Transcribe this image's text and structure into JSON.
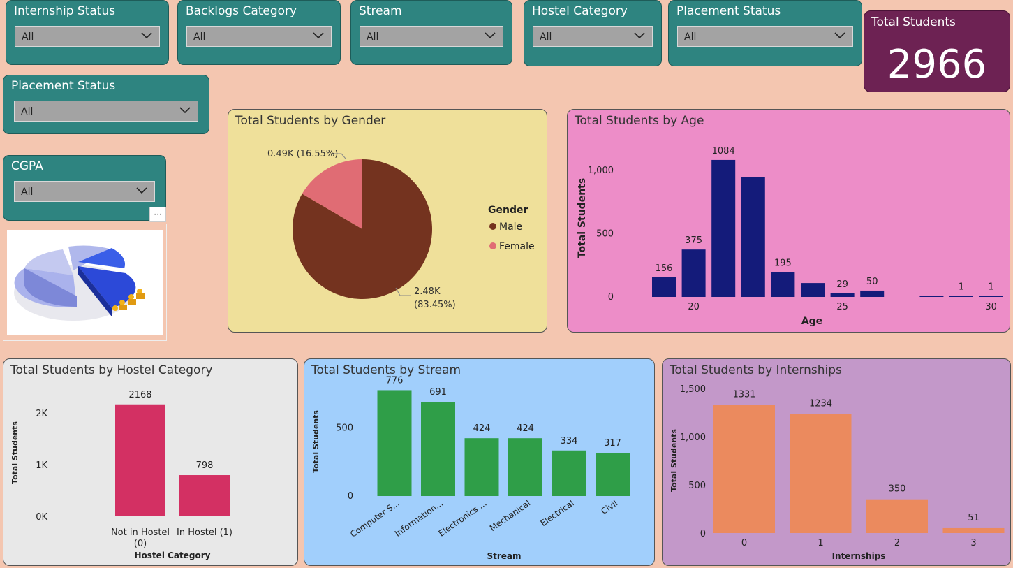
{
  "slicers": [
    {
      "title": "Internship Status",
      "value": "All"
    },
    {
      "title": "Backlogs Category",
      "value": "All"
    },
    {
      "title": "Stream",
      "value": "All"
    },
    {
      "title": "Hostel Category",
      "value": "All"
    },
    {
      "title": "Placement Status",
      "value": "All"
    },
    {
      "title": "Placement Status",
      "value": "All"
    },
    {
      "title": "CGPA",
      "value": "All"
    }
  ],
  "kpi": {
    "label": "Total Students",
    "value": "2966",
    "color": "#6d2253"
  },
  "more_options": "···",
  "chart_data": [
    {
      "type": "pie",
      "title": "Total Students by Gender",
      "legend_title": "Gender",
      "legend_position": "right",
      "slices": [
        {
          "label": "Male",
          "value": 2480,
          "percent": 83.45,
          "data_label_value": "2.48K",
          "data_label_pct": "(83.45%)",
          "color": "#74331f"
        },
        {
          "label": "Female",
          "value": 490,
          "percent": 16.55,
          "data_label_value": "0.49K",
          "data_label_pct": "(16.55%)",
          "color": "#e06c74"
        }
      ],
      "background": "#efe09a"
    },
    {
      "type": "bar",
      "title": "Total Students by Age",
      "xlabel": "Age",
      "ylabel": "Total Students",
      "x_ticks": [
        "20",
        "25",
        "30"
      ],
      "y_ticks": [
        "0",
        "500",
        "1,000"
      ],
      "ylim": [
        0,
        1150
      ],
      "x": [
        19,
        20,
        21,
        22,
        23,
        24,
        25,
        26,
        28,
        29,
        30
      ],
      "values": [
        156,
        375,
        1084,
        950,
        195,
        110,
        29,
        50,
        0,
        1,
        1
      ],
      "data_labels": [
        "156",
        "375",
        "1084",
        "",
        "195",
        "",
        "29",
        "50",
        "",
        "1",
        "1"
      ],
      "color": "#141b7a",
      "background": "#ed8dc8"
    },
    {
      "type": "bar",
      "title": "Total Students by Hostel Category",
      "xlabel": "Hostel Category",
      "ylabel": "Total Students",
      "categories": [
        [
          "Not in Hostel",
          "(0)"
        ],
        [
          "In Hostel (1)"
        ]
      ],
      "values": [
        2168,
        798
      ],
      "data_labels": [
        "2168",
        "798"
      ],
      "y_ticks": [
        "0K",
        "1K",
        "2K"
      ],
      "ylim": [
        0,
        2300
      ],
      "color": "#d33063",
      "background": "#e8e8e8"
    },
    {
      "type": "bar",
      "title": "Total Students by Stream",
      "xlabel": "Stream",
      "ylabel": "Total Students",
      "categories": [
        "Computer S...",
        "Information...",
        "Electronics ...",
        "Mechanical",
        "Electrical",
        "Civil"
      ],
      "values": [
        776,
        691,
        424,
        424,
        334,
        317
      ],
      "data_labels": [
        "776",
        "691",
        "424",
        "424",
        "334",
        "317"
      ],
      "y_ticks": [
        "0",
        "500"
      ],
      "ylim": [
        0,
        850
      ],
      "color": "#2f9e48",
      "background": "#a1cffc"
    },
    {
      "type": "bar",
      "title": "Total Students by Internships",
      "xlabel": "Internships",
      "ylabel": "Total Students",
      "categories": [
        "0",
        "1",
        "2",
        "3"
      ],
      "values": [
        1331,
        1234,
        350,
        51
      ],
      "data_labels": [
        "1331",
        "1234",
        "350",
        "51"
      ],
      "y_ticks": [
        "0",
        "500",
        "1,000",
        "1,500"
      ],
      "ylim": [
        0,
        1500
      ],
      "color": "#eb8a5e",
      "background": "#c398c9"
    }
  ]
}
